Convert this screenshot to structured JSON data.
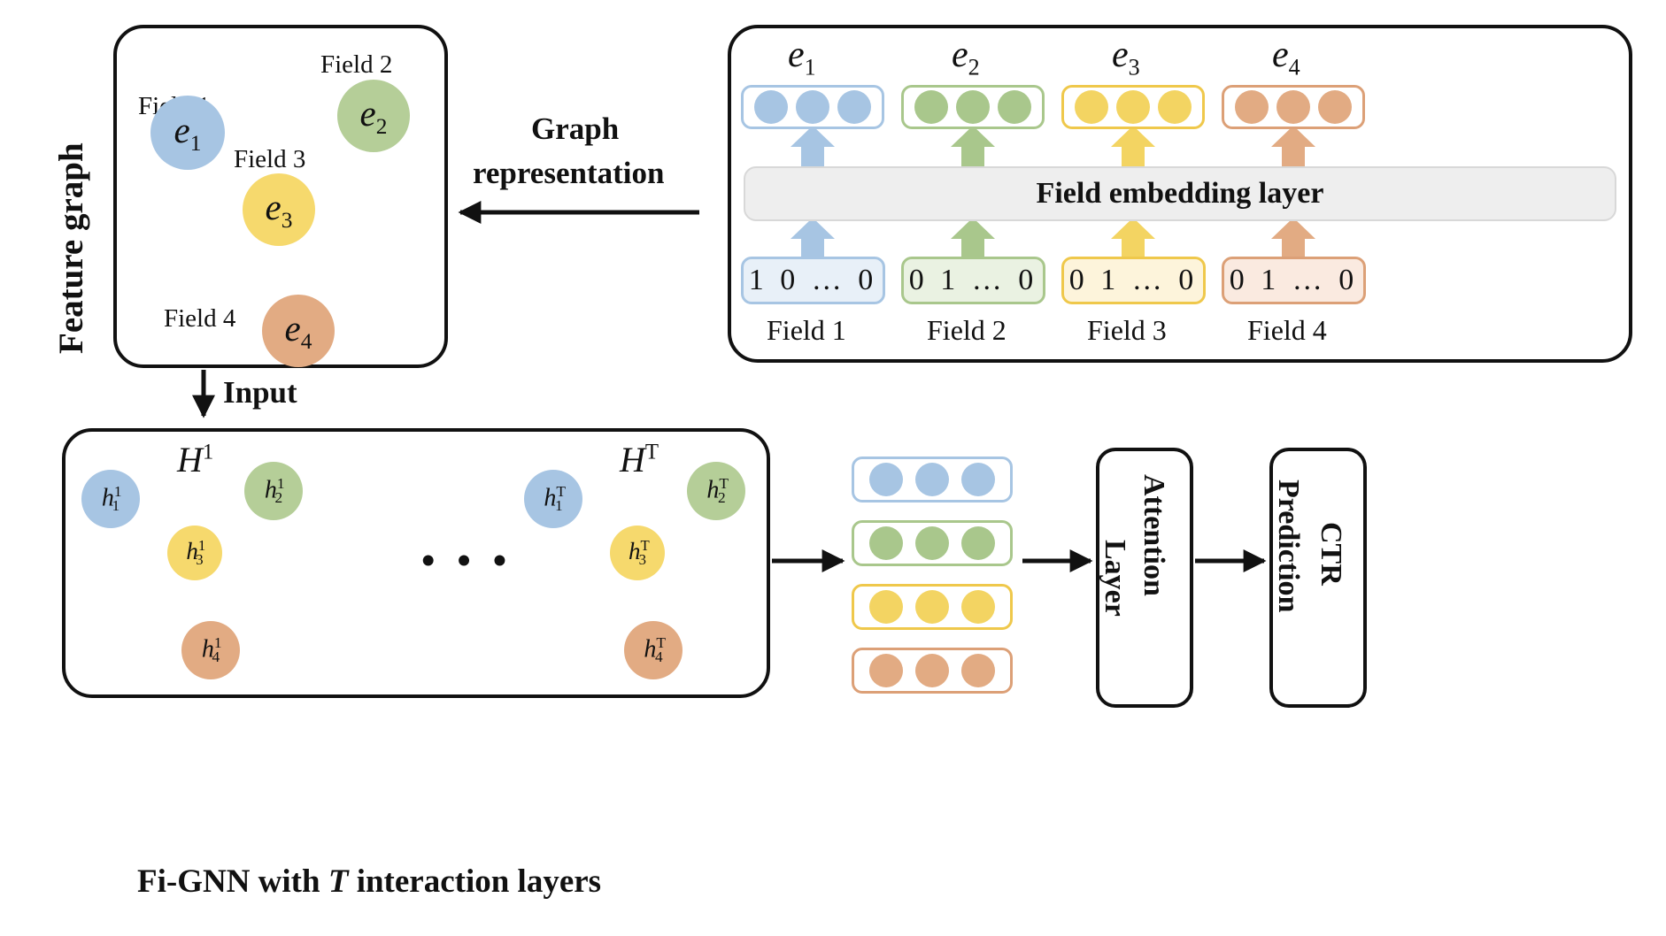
{
  "figure": {
    "caption": "Fi-GNN with T interaction layers",
    "caption_pre": "Fi-GNN with ",
    "caption_italic": "T",
    "caption_post": " interaction layers"
  },
  "labels": {
    "feature_graph": "Feature graph",
    "graph_representation_line1": "Graph",
    "graph_representation_line2": "representation",
    "input": "Input",
    "ellipsis": "• • •"
  },
  "feature_graph_panel": {
    "field_labels": [
      "Field 1",
      "Field 2",
      "Field 3",
      "Field 4"
    ],
    "nodes": [
      {
        "id": "e1",
        "base": "e",
        "sub": "1",
        "color": "#a7c5e3",
        "field": "Field 1"
      },
      {
        "id": "e2",
        "base": "e",
        "sub": "2",
        "color": "#b5ce98",
        "field": "Field 2"
      },
      {
        "id": "e3",
        "base": "e",
        "sub": "3",
        "color": "#f6d96d",
        "field": "Field 3"
      },
      {
        "id": "e4",
        "base": "e",
        "sub": "4",
        "color": "#e2ab83",
        "field": "Field 4"
      }
    ]
  },
  "embedding_panel": {
    "embed_layer_label": "Field embedding layer",
    "columns": [
      {
        "symbol_base": "e",
        "symbol_sub": "1",
        "onehot": "1  0 … 0",
        "field": "Field 1",
        "color": "#a7c5e3"
      },
      {
        "symbol_base": "e",
        "symbol_sub": "2",
        "onehot": "0  1 … 0",
        "field": "Field 2",
        "color": "#a9c78c"
      },
      {
        "symbol_base": "e",
        "symbol_sub": "3",
        "onehot": "0  1 … 0",
        "field": "Field 3",
        "color": "#f3d462"
      },
      {
        "symbol_base": "e",
        "symbol_sub": "4",
        "onehot": "0  1 … 0",
        "field": "Field 4",
        "color": "#e2ab83"
      }
    ]
  },
  "gnn_panel": {
    "state_left_base": "H",
    "state_left_sup": "1",
    "state_right_base": "H",
    "state_right_sup": "T",
    "nodes_left": [
      {
        "base": "h",
        "sub": "1",
        "sup": "1",
        "color": "#a7c5e3"
      },
      {
        "base": "h",
        "sub": "2",
        "sup": "1",
        "color": "#b5ce98"
      },
      {
        "base": "h",
        "sub": "3",
        "sup": "1",
        "color": "#f6d96d"
      },
      {
        "base": "h",
        "sub": "4",
        "sup": "1",
        "color": "#e2ab83"
      }
    ],
    "nodes_right": [
      {
        "base": "h",
        "sub": "1",
        "sup": "T",
        "color": "#a7c5e3"
      },
      {
        "base": "h",
        "sub": "2",
        "sup": "T",
        "color": "#b5ce98"
      },
      {
        "base": "h",
        "sub": "3",
        "sup": "T",
        "color": "#f6d96d"
      },
      {
        "base": "h",
        "sub": "4",
        "sup": "T",
        "color": "#e2ab83"
      }
    ]
  },
  "output_vectors": {
    "rows": [
      {
        "color": "#a7c5e3",
        "border": "#a7c5e3",
        "dots": 3
      },
      {
        "color": "#a9c78c",
        "border": "#a9c78c",
        "dots": 3
      },
      {
        "color": "#f3d462",
        "border": "#efc84b",
        "dots": 3
      },
      {
        "color": "#e2ab83",
        "border": "#dca077",
        "dots": 3
      }
    ]
  },
  "stages": {
    "attention_line1": "Attention",
    "attention_line2": "Layer",
    "ctr_line1": "CTR",
    "ctr_line2": "Prediction"
  },
  "colors": {
    "blue": "#a7c5e3",
    "green": "#b5ce98",
    "yellow": "#f6d96d",
    "orange": "#e2ab83",
    "gray_bar": "#eeeeee",
    "stroke": "#111111"
  }
}
